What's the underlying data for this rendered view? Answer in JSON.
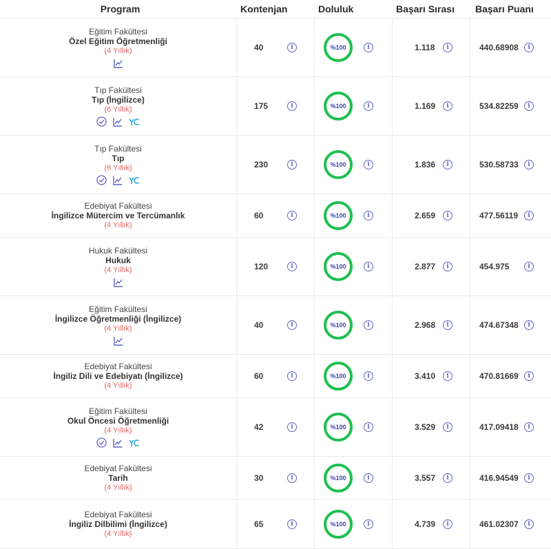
{
  "headers": {
    "program": "Program",
    "kontenjan": "Kontenjan",
    "doluluk": "Doluluk",
    "sira": "Başarı Sırası",
    "puan": "Başarı Puanı"
  },
  "colors": {
    "accent": "#1fbf4f",
    "duration": "#e56363",
    "icon": "#5d64c4"
  },
  "rows": [
    {
      "faculty": "Eğitim Fakültesi",
      "program": "Özel Eğitim Öğretmenliği",
      "duration": "(4 Yıllık)",
      "icons": [
        "chart-icon"
      ],
      "kontenjan": "40",
      "doluluk": "%100",
      "sira": "1.118",
      "puan": "440.68908"
    },
    {
      "faculty": "Tıp Fakültesi",
      "program": "Tıp (İngilizce)",
      "duration": "(6 Yıllık)",
      "icons": [
        "check-circle-icon",
        "chart-icon",
        "yok-icon"
      ],
      "kontenjan": "175",
      "doluluk": "%100",
      "sira": "1.169",
      "puan": "534.82259"
    },
    {
      "faculty": "Tıp Fakültesi",
      "program": "Tıp",
      "duration": "(6 Yıllık)",
      "icons": [
        "check-circle-icon",
        "chart-icon",
        "yok-icon"
      ],
      "kontenjan": "230",
      "doluluk": "%100",
      "sira": "1.836",
      "puan": "530.58733"
    },
    {
      "faculty": "Edebiyat Fakültesi",
      "program": "İngilizce Mütercim ve Tercümanlık",
      "duration": "(4 Yıllık)",
      "icons": [],
      "kontenjan": "60",
      "doluluk": "%100",
      "sira": "2.659",
      "puan": "477.56119"
    },
    {
      "faculty": "Hukuk Fakültesi",
      "program": "Hukuk",
      "duration": "(4 Yıllık)",
      "icons": [
        "chart-icon"
      ],
      "kontenjan": "120",
      "doluluk": "%100",
      "sira": "2.877",
      "puan": "454.975"
    },
    {
      "faculty": "Eğitim Fakültesi",
      "program": "İngilizce Öğretmenliği (İngilizce)",
      "duration": "(4 Yıllık)",
      "icons": [
        "chart-icon"
      ],
      "kontenjan": "40",
      "doluluk": "%100",
      "sira": "2.968",
      "puan": "474.67348"
    },
    {
      "faculty": "Edebiyat Fakültesi",
      "program": "İngiliz Dili ve Edebiyatı (İngilizce)",
      "duration": "(4 Yıllık)",
      "icons": [],
      "kontenjan": "60",
      "doluluk": "%100",
      "sira": "3.410",
      "puan": "470.81669"
    },
    {
      "faculty": "Eğitim Fakültesi",
      "program": "Okul Öncesi Öğretmenliği",
      "duration": "(4 Yıllık)",
      "icons": [
        "check-circle-icon",
        "chart-icon",
        "yok-icon"
      ],
      "kontenjan": "42",
      "doluluk": "%100",
      "sira": "3.529",
      "puan": "417.09418"
    },
    {
      "faculty": "Edebiyat Fakültesi",
      "program": "Tarih",
      "duration": "(4 Yıllık)",
      "icons": [],
      "kontenjan": "30",
      "doluluk": "%100",
      "sira": "3.557",
      "puan": "416.94549"
    },
    {
      "faculty": "Edebiyat Fakültesi",
      "program": "İngiliz Dilbilimi (İngilizce)",
      "duration": "(4 Yıllık)",
      "icons": [],
      "kontenjan": "65",
      "doluluk": "%100",
      "sira": "4.739",
      "puan": "461.02307"
    }
  ]
}
